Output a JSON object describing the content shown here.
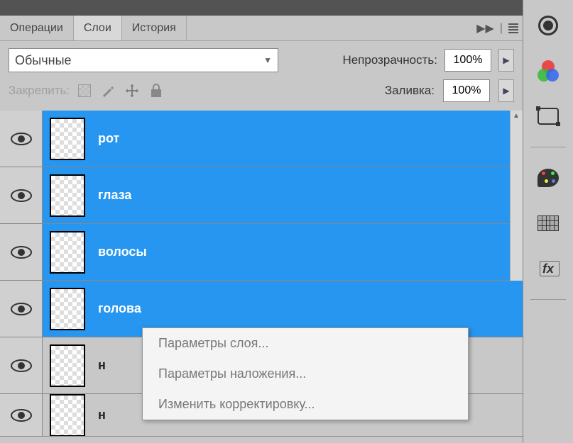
{
  "tabs": {
    "actions": "Операции",
    "layers": "Слои",
    "history": "История"
  },
  "blend_mode": "Обычные",
  "opacity": {
    "label": "Непрозрачность:",
    "value": "100%"
  },
  "fill": {
    "label": "Заливка:",
    "value": "100%"
  },
  "lock_label": "Закрепить:",
  "layers": [
    {
      "name": "рот",
      "selected": true
    },
    {
      "name": "глаза",
      "selected": true
    },
    {
      "name": "волосы",
      "selected": true
    },
    {
      "name": "голова",
      "selected": true
    },
    {
      "name": "н",
      "selected": false
    },
    {
      "name": "н",
      "selected": false
    }
  ],
  "context_menu": {
    "items": [
      "Параметры слоя...",
      "Параметры наложения...",
      "Изменить корректировку..."
    ]
  },
  "colors": {
    "selection": "#2696f0",
    "panel": "#c8c8c8"
  }
}
